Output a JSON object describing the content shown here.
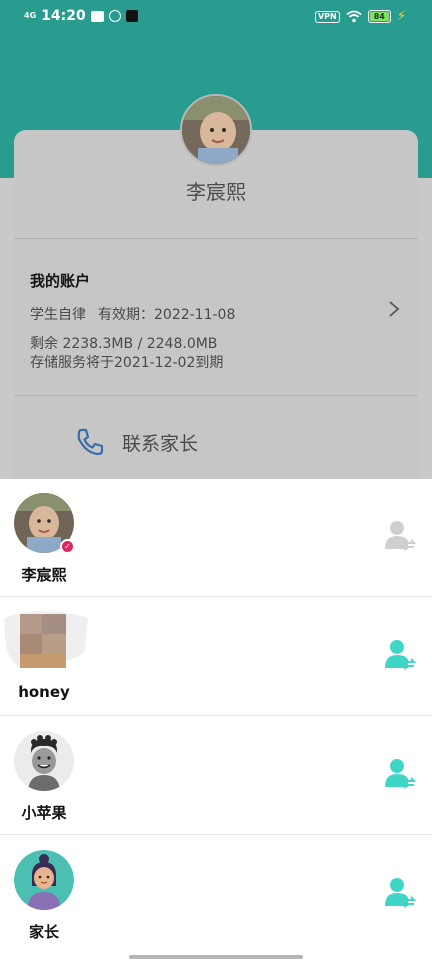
{
  "status_bar": {
    "network": "4G",
    "time": "14:20",
    "vpn": "VPN",
    "battery": "84"
  },
  "profile": {
    "name": "李宸熙",
    "avatar_icon": "child-photo-avatar"
  },
  "account": {
    "title": "我的账户",
    "plan": "学生自律",
    "validity": "有效期：2022-11-08",
    "storage": "剩余 2238.3MB / 2248.0MB",
    "expiry_notice": "存储服务将于2021-12-02到期"
  },
  "contact": {
    "label": "联系家长",
    "icon": "phone-icon"
  },
  "members": [
    {
      "name": "李宸熙",
      "avatar": "child-photo",
      "switch_state": "current",
      "switch_color": "#cfcfcf"
    },
    {
      "name": "honey",
      "avatar": "blurred-photo",
      "switch_state": "available",
      "switch_color": "#3fd6c7"
    },
    {
      "name": "小苹果",
      "avatar": "boy-cartoon",
      "switch_state": "available",
      "switch_color": "#3fd6c7"
    },
    {
      "name": "家长",
      "avatar": "woman-cartoon",
      "switch_state": "available",
      "switch_color": "#3fd6c7"
    }
  ],
  "colors": {
    "header_teal": "#279c8f",
    "accent_teal": "#3fd6c7",
    "badge_pink": "#e0245e"
  }
}
